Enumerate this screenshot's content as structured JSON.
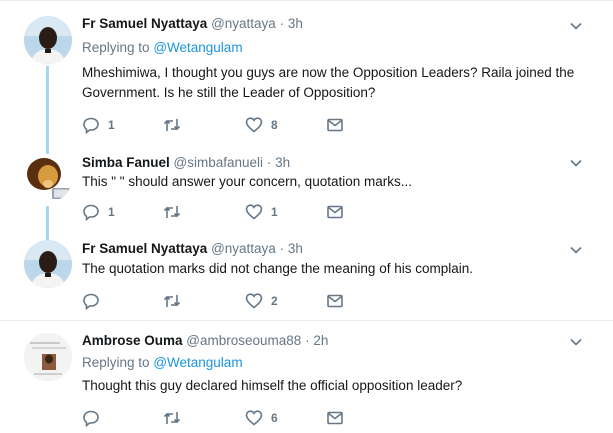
{
  "tweets": [
    {
      "name": "Fr Samuel Nyattaya",
      "handle": "@nyattaya",
      "separator": "·",
      "time": "3h",
      "replying_prefix": "Replying to",
      "replying_to": "@Wetangulam",
      "text": "Mheshimiwa, I thought you guys are now the Opposition Leaders? Raila joined the Government. Is he still the Leader of Opposition?",
      "reply_count": "1",
      "retweet_count": "",
      "like_count": "8"
    },
    {
      "name": "Simba Fanuel",
      "handle": "@simbafanueli",
      "separator": "·",
      "time": "3h",
      "text": "This \" \" should answer your concern, quotation marks...",
      "reply_count": "1",
      "retweet_count": "",
      "like_count": "1"
    },
    {
      "name": "Fr Samuel Nyattaya",
      "handle": "@nyattaya",
      "separator": "·",
      "time": "3h",
      "text": "The quotation marks did not change the meaning of his complain.",
      "reply_count": "",
      "retweet_count": "",
      "like_count": "2"
    },
    {
      "name": "Ambrose Ouma",
      "handle": "@ambroseouma88",
      "separator": "·",
      "time": "2h",
      "replying_prefix": "Replying to",
      "replying_to": "@Wetangulam",
      "text": "Thought this guy declared himself the official opposition leader?",
      "reply_count": "",
      "retweet_count": "",
      "like_count": "6"
    }
  ],
  "icons": {
    "reply": "reply-icon",
    "retweet": "retweet-icon",
    "like": "heart-icon",
    "dm": "envelope-icon",
    "menu": "chevron-down-icon"
  },
  "colors": {
    "link": "#1b95e0",
    "secondary": "#657786",
    "thread_line": "#a7d7f1",
    "divider": "#e6ecf0"
  }
}
